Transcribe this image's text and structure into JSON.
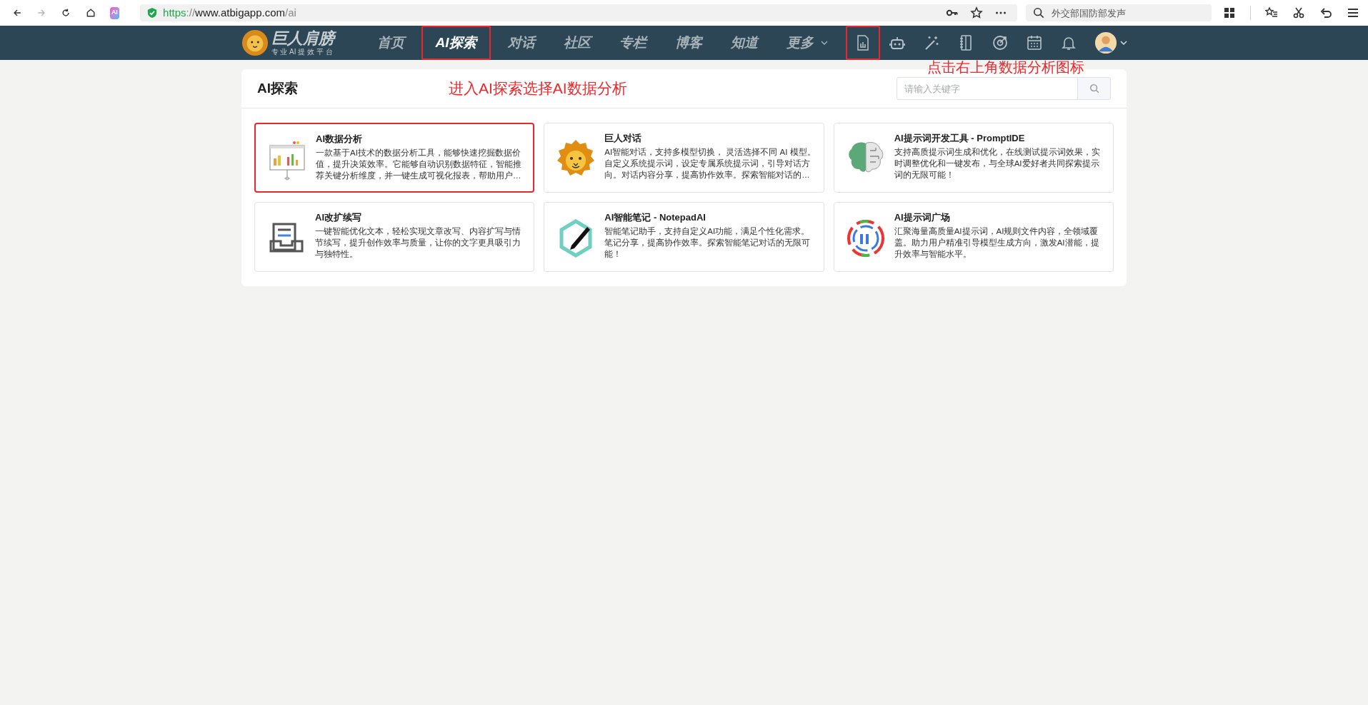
{
  "browser": {
    "nav_buttons": [
      {
        "kind": "back",
        "disabled": false
      },
      {
        "kind": "forward",
        "disabled": true
      },
      {
        "kind": "reload",
        "disabled": false
      },
      {
        "kind": "home",
        "disabled": false
      }
    ],
    "app_badge": "AI",
    "url": [
      {
        "text": "https",
        "kind": "scheme"
      },
      {
        "text": "://",
        "kind": "muted"
      },
      {
        "text": "www.atbigapp.com",
        "kind": "host"
      },
      {
        "text": "/ai",
        "kind": "muted"
      }
    ],
    "search": {
      "placeholder": "外交部国防部发声"
    }
  },
  "site_nav": {
    "logo": {
      "name": "巨人肩膀",
      "tagline": "专 业 AI 提 效 平 台"
    },
    "items": [
      {
        "label": "首页",
        "selected": false,
        "highlighted": false
      },
      {
        "label": "AI探索",
        "selected": true,
        "highlighted": true
      },
      {
        "label": "对话",
        "selected": false,
        "highlighted": false
      },
      {
        "label": "社区",
        "selected": false,
        "highlighted": false
      },
      {
        "label": "专栏",
        "selected": false,
        "highlighted": false
      },
      {
        "label": "博客",
        "selected": false,
        "highlighted": false
      },
      {
        "label": "知道",
        "selected": false,
        "highlighted": false
      },
      {
        "label": "更多",
        "selected": false,
        "highlighted": false,
        "dropdown": true
      }
    ],
    "icons": [
      {
        "kind": "chart",
        "highlighted": true
      },
      {
        "kind": "robot",
        "highlighted": false
      },
      {
        "kind": "wand",
        "highlighted": false
      },
      {
        "kind": "notebook",
        "highlighted": false
      },
      {
        "kind": "target",
        "highlighted": false
      },
      {
        "kind": "calendar",
        "highlighted": false
      },
      {
        "kind": "bell",
        "highlighted": false
      }
    ],
    "annotation": "点击右上角数据分析图标"
  },
  "panel": {
    "title": "AI探索",
    "annotation": "进入AI探索选择AI数据分析",
    "search": {
      "placeholder": "请输入关键字"
    },
    "cards": [
      {
        "kind": "chart",
        "title": "AI数据分析",
        "description": "一款基于AI技术的数据分析工具，能够快速挖掘数据价值，提升决策效率。它能够自动识别数据特征，智能推荐关键分析维度，并一键生成可视化报表，帮助用户…",
        "highlighted": true
      },
      {
        "kind": "lion",
        "title": "巨人对话",
        "description": "AI智能对话，支持多模型切换， 灵活选择不同 AI 模型。自定义系统提示词，设定专属系统提示词，引导对话方向。对话内容分享，提高协作效率。探索智能对话的…",
        "highlighted": false
      },
      {
        "kind": "brain",
        "title": "AI提示词开发工具 - PromptIDE",
        "description": "支持高质提示词生成和优化，在线测试提示词效果，实时调整优化和一键发布，与全球AI爱好者共同探索提示词的无限可能！",
        "highlighted": false
      },
      {
        "kind": "tray",
        "title": "AI改扩续写",
        "description": "一键智能优化文本，轻松实现文章改写、内容扩写与情节续写，提升创作效率与质量，让你的文字更具吸引力与独特性。",
        "highlighted": false
      },
      {
        "kind": "pen",
        "title": "AI智能笔记 - NotepadAI",
        "description": "智能笔记助手，支持自定义AI功能，满足个性化需求。笔记分享，提高协作效率。探索智能笔记对话的无限可能！",
        "highlighted": false
      },
      {
        "kind": "ring",
        "title": "AI提示词广场",
        "description": "汇聚海量高质量AI提示词，AI规则文件内容，全领域覆盖。助力用户精准引导模型生成方向，激发AI潜能，提升效率与智能水平。",
        "highlighted": false
      }
    ]
  }
}
